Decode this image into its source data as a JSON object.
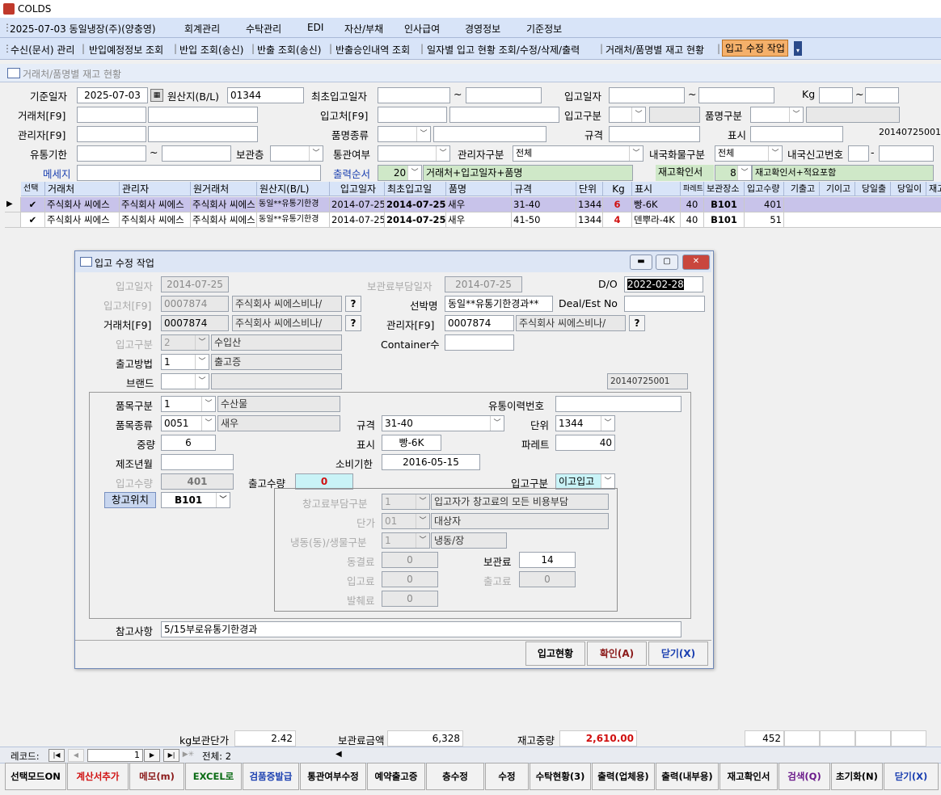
{
  "app": {
    "title": "COLDS"
  },
  "menu": [
    "2025-07-03 동일냉장(주)(양충영)",
    "회계관리",
    "수탁관리",
    "EDI",
    "자산/부채",
    "인사급여",
    "경영정보",
    "기준정보"
  ],
  "toolbar": [
    "수신(문서) 관리",
    "반입예정정보 조회",
    "반입 조회(송신)",
    "반출 조회(송신)",
    "반출승인내역 조회",
    "일자별 입고 현황 조회/수정/삭제/출력",
    "거래처/품명별 재고 현황",
    "입고 수정 작업"
  ],
  "subform_title": "거래처/품명별 재고 현황",
  "filters": {
    "base_date_label": "기준일자",
    "base_date": "2025-07-03",
    "origin_label": "원산지(B/L)",
    "origin": "01344",
    "first_in_label": "최초입고일자",
    "tilde": "~",
    "in_date_label": "입고일자",
    "kg_label": "Kg",
    "client_label": "거래처[F9]",
    "stock_place_label": "입고처[F9]",
    "in_type_label": "입고구분",
    "item_type_label": "품명구분",
    "manager_label": "관리자[F9]",
    "item_kind_label": "품명종류",
    "spec_label": "규격",
    "mark_label": "표시",
    "code_right": "20140725001",
    "expire_label": "유통기한",
    "storage_floor_label": "보관층",
    "customs_label": "통관여부",
    "mgr_type_label": "관리자구분",
    "mgr_type": "전체",
    "domestic_label": "내국화물구분",
    "domestic": "전체",
    "domestic_no_label": "내국신고번호",
    "dash": "-",
    "message_label": "메세지",
    "output_order_label": "출력순서",
    "output_order_no": "20",
    "output_order_text": "거래처+입고일자+품명",
    "confirm_label": "재고확인서",
    "confirm_no": "8",
    "confirm_text": "재고확인서+적요포함"
  },
  "grid": {
    "headers": [
      "선택",
      "거래처",
      "관리자",
      "원거래처",
      "원산지(B/L)",
      "입고일자",
      "최초입고일",
      "품명",
      "규격",
      "단위",
      "Kg",
      "표시",
      "파레트",
      "보관장소",
      "입고수량",
      "기출고",
      "기이고",
      "당일출",
      "당일이",
      "재고"
    ],
    "rows": [
      [
        "✔",
        "주식회사 씨에스",
        "주식회사 씨에스",
        "주식회사 씨에스",
        "동일**유통기한경",
        "2014-07-25",
        "2014-07-25",
        "새우",
        "31-40",
        "1344",
        "6",
        "빵-6K",
        "40",
        "B101",
        "401"
      ],
      [
        "✔",
        "주식회사 씨에스",
        "주식회사 씨에스",
        "주식회사 씨에스",
        "동일**유통기한경",
        "2014-07-25",
        "2014-07-25",
        "새우",
        "41-50",
        "1344",
        "4",
        "덴뿌라-4K",
        "40",
        "B101",
        "51"
      ]
    ]
  },
  "dialog": {
    "title": "입고 수정 작업",
    "in_date_label": "입고일자",
    "in_date": "2014-07-25",
    "fee_date_label": "보관료부담일자",
    "fee_date": "2014-07-25",
    "do_label": "D/O",
    "do_value": "2022-02-28",
    "stock_place_label": "입고처[F9]",
    "stock_place_code": "0007874",
    "stock_place_name": "주식회사 씨에스비나/",
    "ship_label": "선박명",
    "ship": "동일**유통기한경과**",
    "deal_label": "Deal/Est No",
    "client_label": "거래처[F9]",
    "client_code": "0007874",
    "client_name": "주식회사 씨에스비나/",
    "manager_label": "관리자[F9]",
    "manager_code": "0007874",
    "manager_name": "주식회사 씨에스비나/",
    "q": "?",
    "in_type_label": "입고구분",
    "in_type_no": "2",
    "in_type_name": "수입산",
    "container_label": "Container수",
    "out_method_label": "출고방법",
    "out_method_no": "1",
    "out_method_name": "출고증",
    "brand_label": "브랜드",
    "code": "20140725001",
    "item_type_label": "품목구분",
    "item_type_no": "1",
    "item_type_name": "수산물",
    "trace_label": "유통이력번호",
    "item_kind_label": "품목종류",
    "item_kind_no": "0051",
    "item_kind_name": "새우",
    "spec_label": "규격",
    "spec": "31-40",
    "unit_label": "단위",
    "unit": "1344",
    "weight_label": "중량",
    "weight": "6",
    "mark_label": "표시",
    "mark": "빵-6K",
    "pallet_label": "파레트",
    "pallet": "40",
    "mfg_label": "제조년월",
    "expire_label": "소비기한",
    "expire": "2016-05-15",
    "in_qty_label": "입고수량",
    "in_qty": "401",
    "out_qty_label": "출고수량",
    "out_qty": "0",
    "in_type2_label": "입고구분",
    "in_type2": "이고입고",
    "location_label": "창고위치",
    "location": "B101",
    "fee_bearer_label": "창고료부담구분",
    "fee_bearer_no": "1",
    "fee_bearer_name": "입고자가 창고료의 모든 비용부담",
    "price_label": "단가",
    "price_no": "01",
    "price_name": "대상자",
    "freeze_label": "냉동(동)/생물구분",
    "freeze_no": "1",
    "freeze_name": "냉동/장",
    "freezing_label": "동결료",
    "freezing": "0",
    "storage_fee_label": "보관료",
    "storage_fee": "14",
    "in_fee_label": "입고료",
    "in_fee": "0",
    "out_fee_label": "출고료",
    "out_fee": "0",
    "issue_fee_label": "발췌료",
    "issue_fee": "0",
    "note_label": "참고사항",
    "note": "5/15부로유통기한경과",
    "btn_status": "입고현황",
    "btn_ok": "확인(A)",
    "btn_close": "닫기(X)"
  },
  "footer": {
    "kg_price_label": "kg보관단가",
    "kg_price": "2.42",
    "fee_total_label": "보관료금액",
    "fee_total": "6,328",
    "stock_weight_label": "재고중량",
    "stock_weight": "2,610.00",
    "qty_total": "452",
    "record_label": "레코드:",
    "record_no": "1",
    "record_total": "전체: 2"
  },
  "bottom_buttons": [
    "선택모드ON",
    "계산서추가",
    "메모(m)",
    "EXCEL로",
    "검품증발급",
    "통관여부수정",
    "예약출고증",
    "층수정",
    "수정",
    "수탁현황(3)",
    "출력(업체용)",
    "출력(내부용)",
    "재고확인서",
    "검색(Q)",
    "초기화(N)",
    "닫기(X)"
  ]
}
